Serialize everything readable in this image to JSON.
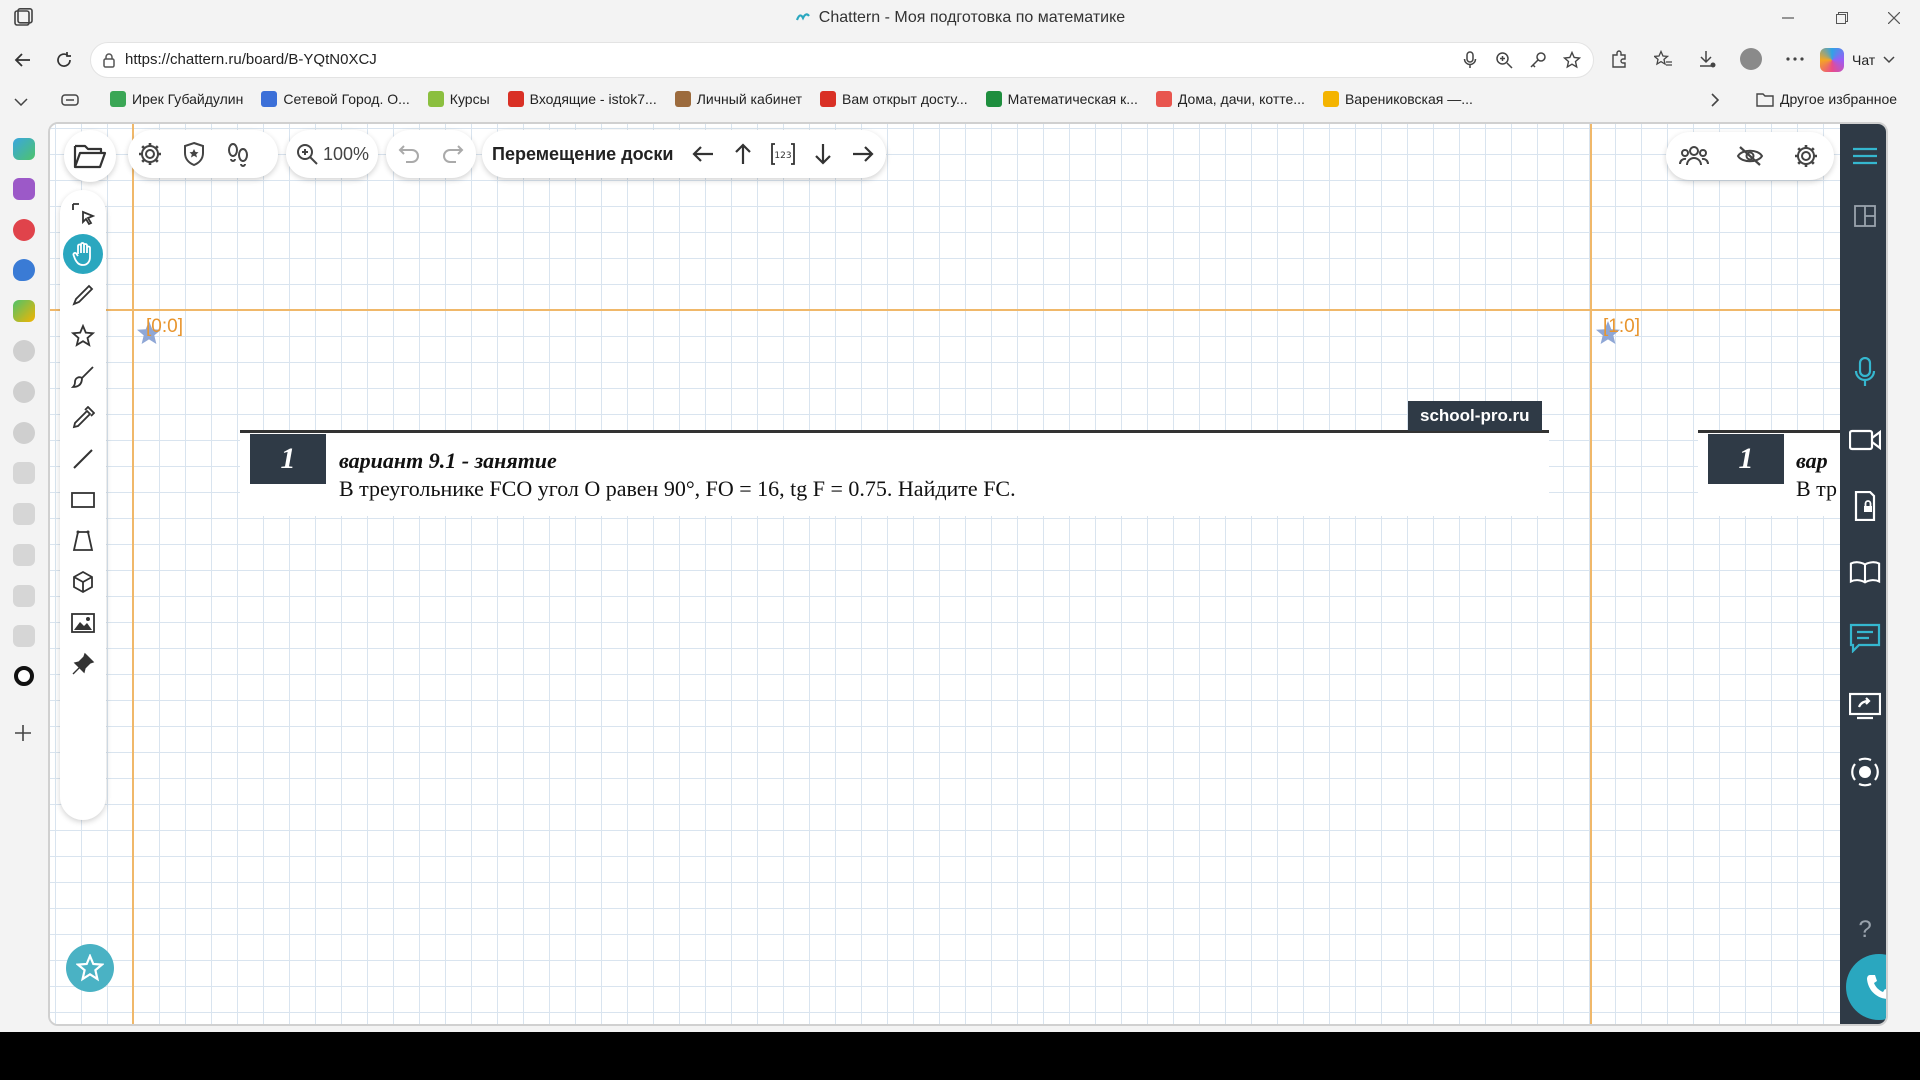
{
  "window": {
    "title": "Chattern - Моя подготовка по математике"
  },
  "browser": {
    "url": "https://chattern.ru/board/B-YQtN0XCJ",
    "copilot_label": "Чат",
    "favorites": [
      {
        "label": "Ирек Губайдулин",
        "color": "#3aa655"
      },
      {
        "label": "Сетевой Город. О...",
        "color": "#3b6fd8"
      },
      {
        "label": "Курсы",
        "color": "#8bbf3f"
      },
      {
        "label": "Входящие - istok7...",
        "color": "#d93025"
      },
      {
        "label": "Личный кабинет",
        "color": "#9c6b3d"
      },
      {
        "label": "Вам открыт досту...",
        "color": "#d93025"
      },
      {
        "label": "Математическая к...",
        "color": "#1e8e3e"
      },
      {
        "label": "Дома, дачи, котте...",
        "color": "#e8554e"
      },
      {
        "label": "Варениковская —...",
        "color": "#f4b400"
      }
    ],
    "other_favorites": "Другое избранное"
  },
  "toolbar": {
    "zoom": "100%",
    "board_move_label": "Перемещение доски"
  },
  "board": {
    "coord_left": "[0:0]",
    "coord_right": "[1:0]",
    "card": {
      "number": "1",
      "heading": "вариант 9.1 - занятие",
      "task": "В треугольнике FCO угол O равен 90°, FO = 16, tg F = 0.75. Найдите FC.",
      "badge": "school-pro.ru"
    },
    "card2": {
      "number": "1",
      "heading": "вар",
      "task": "В тр"
    }
  },
  "right_panel": {
    "help": "?"
  },
  "colors": {
    "accent": "#2aa7bf",
    "panel": "#2f3a46",
    "grid_axis": "#f0b86a"
  }
}
